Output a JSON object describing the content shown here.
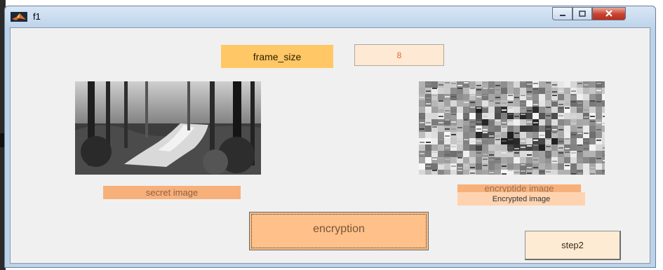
{
  "window": {
    "title": "f1"
  },
  "form": {
    "frame_size_label": "frame_size",
    "frame_size_value": "8",
    "secret_caption": "secret image",
    "encrypted_caption": "encryptide image",
    "encrypted_caption_2": "Encrypted image",
    "encryption_button": "encryption",
    "step2_button": "step2"
  },
  "colors": {
    "label_orange": "#ffc766",
    "caption_orange": "#f8b07a",
    "button_orange": "#ffc08a"
  }
}
